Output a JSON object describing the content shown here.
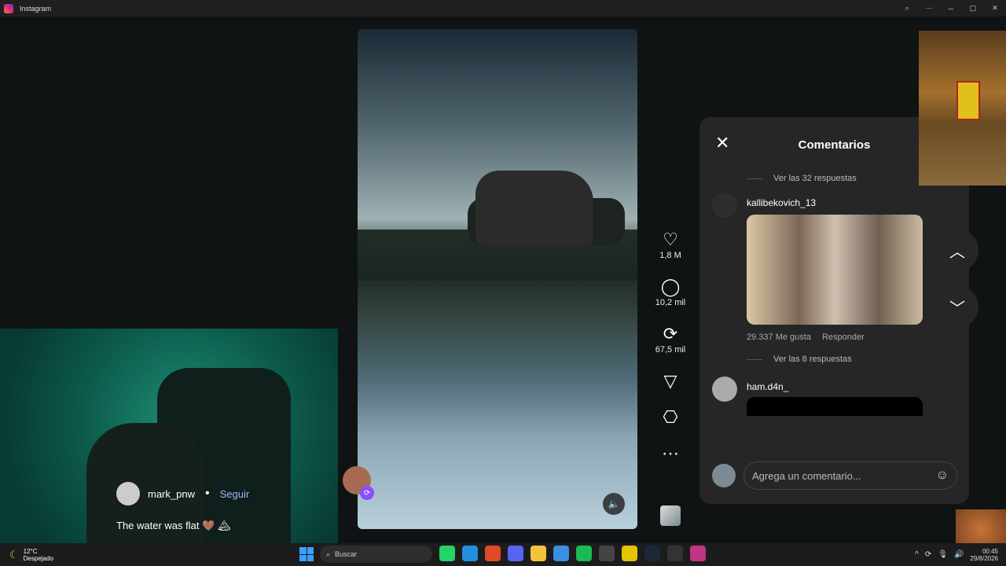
{
  "window": {
    "title": "Instagram",
    "buttons": [
      "⌕",
      "⋯",
      "─",
      "▢",
      "✕"
    ]
  },
  "reel": {
    "mute_icon": "speaker-icon"
  },
  "actions": [
    {
      "name": "like",
      "icon": "♡",
      "count": "1,8 M"
    },
    {
      "name": "comment",
      "icon": "◯",
      "count": "10,2 mil"
    },
    {
      "name": "repost",
      "icon": "⟳",
      "count": "67,5 mil"
    },
    {
      "name": "share",
      "icon": "▽",
      "count": ""
    },
    {
      "name": "save",
      "icon": "⎔",
      "count": ""
    },
    {
      "name": "more",
      "icon": "⋯",
      "count": ""
    }
  ],
  "comments": {
    "title": "Comentarios",
    "close": "✕",
    "replies_top": "Ver las 32 respuestas",
    "item1": {
      "user": "kallibekovich_13",
      "likes": "29.337 Me gusta",
      "reply": "Responder"
    },
    "replies_mid": "Ver las 8 respuestas",
    "item2": {
      "user": "ham.d4n_"
    },
    "composer_placeholder": "Agrega un comentario...",
    "emoji_icon": "☺"
  },
  "nav": {
    "up": "︿",
    "down": "﹀"
  },
  "creator": {
    "name": "mark_pnw",
    "separator": "•",
    "follow": "Seguir",
    "caption": "The water was flat 🤎 🏔"
  },
  "taskbar": {
    "weather_temp": "12°C",
    "weather_desc": "Despejado",
    "search": "Buscar",
    "time": "00:45",
    "date": "29/8/2026"
  }
}
